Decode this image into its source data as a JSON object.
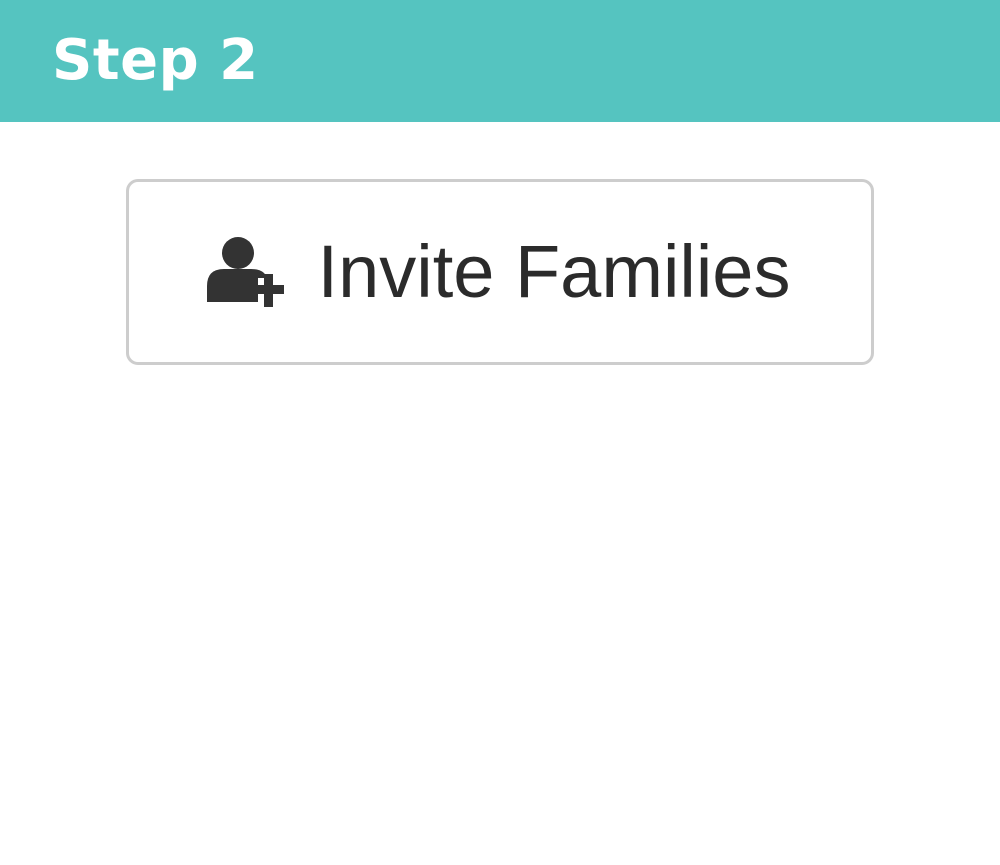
{
  "header": {
    "title": "Step 2",
    "background_color": "#55c4c0",
    "text_color": "#ffffff"
  },
  "main": {
    "invite_button": {
      "label": "Invite Families",
      "icon": "user-plus-icon",
      "text_color": "#2b2b2b",
      "border_color": "#cdcdcd"
    }
  }
}
